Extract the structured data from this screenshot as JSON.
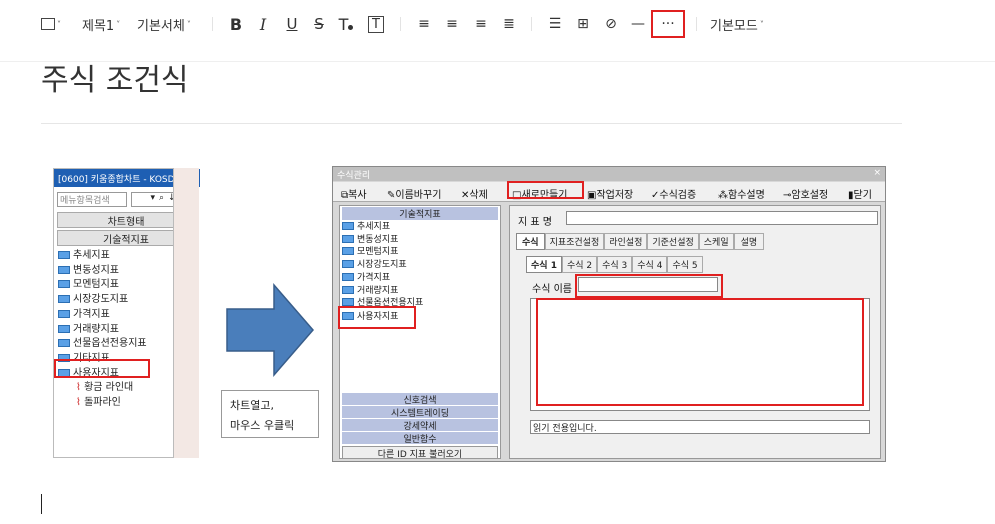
{
  "toolbar": {
    "image_caret": "˅",
    "heading": "제목1",
    "font": "기본서체",
    "bold": "B",
    "italic": "I",
    "underline": "U",
    "strike": "S",
    "clear_format": "T",
    "text_box": "T",
    "more": "···",
    "hr_glyph": "—",
    "mode": "기본모드"
  },
  "doc": {
    "title": "주식 조건식"
  },
  "left": {
    "title": "[0600] 키움종합차트 - KOSD",
    "search_placeholder": "메뉴항목검색",
    "btn_chart": "차트형태",
    "btn_tech": "기술적지표",
    "tree": [
      "추세지표",
      "변동성지표",
      "모멘텀지표",
      "시장강도지표",
      "가격지표",
      "거래량지표",
      "선물옵션전용지표",
      "기타지표",
      "사용자지표"
    ],
    "sub": [
      "황금 라인대",
      "돌파라인"
    ]
  },
  "note": {
    "line1": "차트열고,",
    "line2": "마우스 우클릭"
  },
  "dialog": {
    "title": "수식관리",
    "toolbar": [
      "복사",
      "이름바꾸기",
      "삭제",
      "새로만들기",
      "작업저장",
      "수식검증",
      "함수설명",
      "암호설정",
      "닫기"
    ],
    "tech": "기술적지표",
    "list": [
      "추세지표",
      "변동성지표",
      "모멘텀지표",
      "시장강도지표",
      "가격지표",
      "거래량지표",
      "선물옵션전용지표",
      "사용자지표"
    ],
    "bottom": [
      "신호검색",
      "시스템트레이딩",
      "강세약세",
      "일반함수"
    ],
    "load": "다른 ID 지표 불러오기",
    "name_label": "지 표 명",
    "tabs": [
      "수식",
      "지표조건설정",
      "라인설정",
      "기준선설정",
      "스케일",
      "설명"
    ],
    "subtabs": [
      "수식 1",
      "수식 2",
      "수식 3",
      "수식 4",
      "수식 5"
    ],
    "formula_label": "수식 이름",
    "readonly": "읽기 전용입니다."
  }
}
